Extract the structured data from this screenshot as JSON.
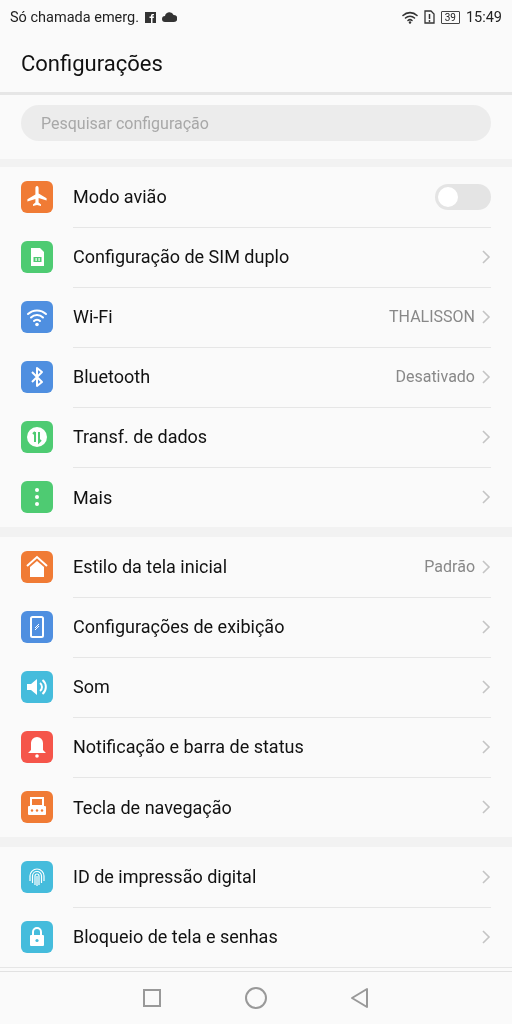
{
  "status_bar": {
    "carrier": "Só chamada emerg.",
    "battery": "39",
    "time": "15:49"
  },
  "header": {
    "title": "Configurações"
  },
  "search": {
    "placeholder": "Pesquisar configuração"
  },
  "sections": [
    {
      "items": [
        {
          "label": "Modo avião",
          "kind": "switch",
          "on": false
        },
        {
          "label": "Configuração de SIM duplo",
          "kind": "link"
        },
        {
          "label": "Wi-Fi",
          "value": "THALISSON",
          "kind": "link"
        },
        {
          "label": "Bluetooth",
          "value": "Desativado",
          "kind": "link"
        },
        {
          "label": "Transf. de dados",
          "kind": "link"
        },
        {
          "label": "Mais",
          "kind": "link"
        }
      ]
    },
    {
      "items": [
        {
          "label": "Estilo da tela inicial",
          "value": "Padrão",
          "kind": "link"
        },
        {
          "label": "Configurações de exibição",
          "kind": "link"
        },
        {
          "label": "Som",
          "kind": "link"
        },
        {
          "label": "Notificação e barra de status",
          "kind": "link"
        },
        {
          "label": "Tecla de navegação",
          "kind": "link"
        }
      ]
    },
    {
      "items": [
        {
          "label": "ID de impressão digital",
          "kind": "link"
        },
        {
          "label": "Bloqueio de tela e senhas",
          "kind": "link"
        }
      ]
    }
  ]
}
